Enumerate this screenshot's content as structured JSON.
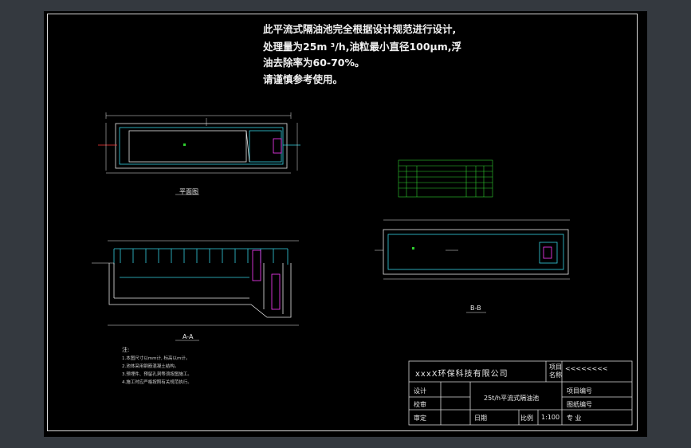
{
  "notes_top": [
    "此平流式隔油池完全根据设计规范进行设计,",
    "处理量为25m ³/h,油粒最小直径100μm,浮",
    "油去除率为60-70%。",
    "请谨慎参考使用。"
  ],
  "views": {
    "plan": "平面图",
    "section_aa": "A-A",
    "section_bb": "B-B"
  },
  "notes": {
    "title": "注:",
    "lines": [
      "1.本图尺寸以mm计, 标高以m计。",
      "2.池体采用钢筋混凝土结构。",
      "3.预埋件、预留孔洞等须按图施工。",
      "4.施工时应严格按照有关规范执行。"
    ]
  },
  "title_block": {
    "company": "xxxX环保科技有限公司",
    "project_name_label": "项目\n名称",
    "project_name_value": "<<<<<<<<",
    "design_label": "设计",
    "review_label": "校审",
    "approve_label": "审定",
    "drawing_title": "25t/h平流式隔油池",
    "project_no_label": "项目编号",
    "drawing_no_label": "图纸编号",
    "date_label": "日期",
    "scale_label": "比例",
    "scale_value": "1:100",
    "discipline_label": "专  业"
  },
  "colors": {
    "background": "#000000",
    "outer": "#34393f",
    "line_white": "#e6e6e6",
    "cyan": "#35d0e0",
    "green": "#2fd02f",
    "magenta": "#ff3cff",
    "red": "#ff3b3b"
  }
}
